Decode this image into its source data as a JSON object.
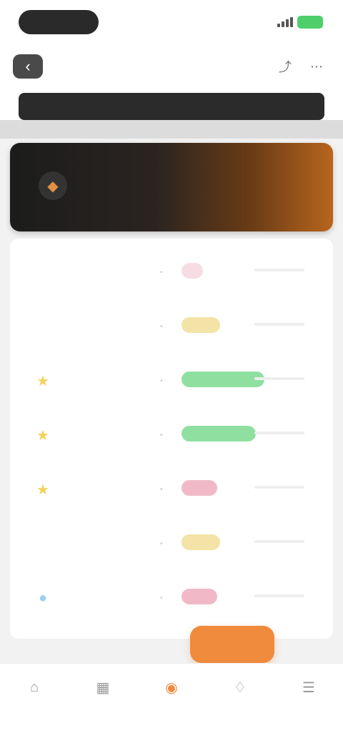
{
  "status_bar": {
    "time": "",
    "battery": ""
  },
  "nav": {
    "back_label": "‹",
    "center_text": "",
    "icons": [
      "share-icon",
      "more-icon"
    ]
  },
  "header": {
    "title": ""
  },
  "banner": {
    "line1": "",
    "line2": "",
    "colors": {
      "start": "#1c1c1c",
      "end": "#b8651e"
    }
  },
  "list": {
    "rows": [
      {
        "lead_icon": "",
        "lead_color": "#e6e6e6",
        "line1": "",
        "line2": "",
        "tag": "",
        "tag_bg": "#f6dde4",
        "tag_color": "#c8587a"
      },
      {
        "lead_icon": "",
        "lead_color": "#e6e6e6",
        "line1": "",
        "line2": "",
        "tag": "",
        "tag_bg": "#f3e3a6",
        "tag_color": "#a88a1a"
      },
      {
        "lead_icon": "★",
        "lead_color": "#f2d25a",
        "line1": "",
        "line2": "",
        "tag": "",
        "tag_bg": "#8fe0a0",
        "tag_color": "#1f8a3a"
      },
      {
        "lead_icon": "★",
        "lead_color": "#f2d25a",
        "line1": "",
        "line2": "",
        "tag": "",
        "tag_bg": "#8fe0a0",
        "tag_color": "#1f8a3a"
      },
      {
        "lead_icon": "★",
        "lead_color": "#f2d25a",
        "line1": "",
        "line2": "",
        "tag": "",
        "tag_bg": "#f1b9c8",
        "tag_color": "#b23a5e"
      },
      {
        "lead_icon": "",
        "lead_color": "#e6e6e6",
        "line1": "",
        "line2": "",
        "tag": "",
        "tag_bg": "#f3e3a6",
        "tag_color": "#a88a1a"
      },
      {
        "lead_icon": "●",
        "lead_color": "#9fd0f0",
        "line1": "",
        "line2": "",
        "tag": "",
        "tag_bg": "#f1b9c8",
        "tag_color": "#b23a5e"
      }
    ]
  },
  "fab": {
    "label": ""
  },
  "tabs": [
    {
      "label": "",
      "icon": "⌂",
      "active": false
    },
    {
      "label": "",
      "icon": "▦",
      "active": false
    },
    {
      "label": "",
      "icon": "◉",
      "active": true
    },
    {
      "label": "",
      "icon": "♢",
      "active": false
    },
    {
      "label": "",
      "icon": "☰",
      "active": false
    }
  ],
  "accent_color": "#f08a3c"
}
